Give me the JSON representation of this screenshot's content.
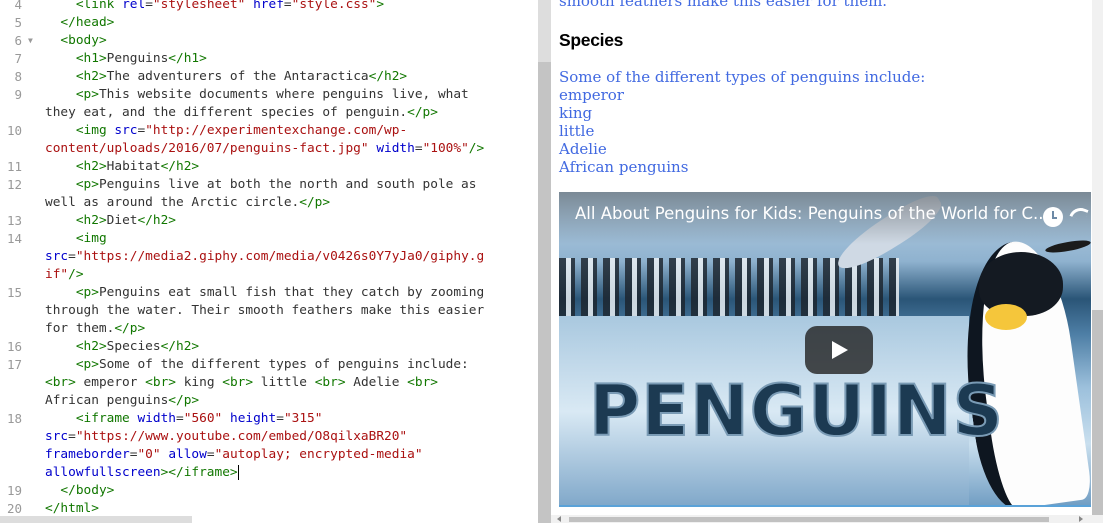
{
  "editor": {
    "lines": [
      {
        "number": "4",
        "fold": "",
        "rows": [
          [
            [
              "p",
              "    "
            ],
            [
              "t",
              "<link"
            ],
            [
              "p",
              " "
            ],
            [
              "a",
              "rel"
            ],
            [
              "p",
              "="
            ],
            [
              "s",
              "\"stylesheet\""
            ],
            [
              "p",
              " "
            ],
            [
              "a",
              "href"
            ],
            [
              "p",
              "="
            ],
            [
              "s",
              "\"style.css\""
            ],
            [
              "t",
              ">"
            ]
          ]
        ]
      },
      {
        "number": "5",
        "fold": "",
        "rows": [
          [
            [
              "p",
              "  "
            ],
            [
              "t",
              "</head>"
            ]
          ]
        ]
      },
      {
        "number": "6",
        "fold": "▼",
        "rows": [
          [
            [
              "p",
              "  "
            ],
            [
              "t",
              "<body>"
            ]
          ]
        ]
      },
      {
        "number": "7",
        "fold": "",
        "rows": [
          [
            [
              "p",
              "    "
            ],
            [
              "t",
              "<h1>"
            ],
            [
              "p",
              "Penguins"
            ],
            [
              "t",
              "</h1>"
            ]
          ]
        ]
      },
      {
        "number": "8",
        "fold": "",
        "rows": [
          [
            [
              "p",
              "    "
            ],
            [
              "t",
              "<h2>"
            ],
            [
              "p",
              "The adventurers of the Antaractica"
            ],
            [
              "t",
              "</h2>"
            ]
          ]
        ]
      },
      {
        "number": "9",
        "fold": "",
        "rows": [
          [
            [
              "p",
              "    "
            ],
            [
              "t",
              "<p>"
            ],
            [
              "p",
              "This website documents where penguins live, what"
            ]
          ],
          [
            [
              "p",
              "they eat, and the different species of penguin."
            ],
            [
              "t",
              "</p>"
            ]
          ]
        ]
      },
      {
        "number": "10",
        "fold": "",
        "rows": [
          [
            [
              "p",
              "    "
            ],
            [
              "t",
              "<img"
            ],
            [
              "p",
              " "
            ],
            [
              "a",
              "src"
            ],
            [
              "p",
              "="
            ],
            [
              "s",
              "\"http://experimentexchange.com/wp-"
            ]
          ],
          [
            [
              "s",
              "content/uploads/2016/07/penguins-fact.jpg\""
            ],
            [
              "p",
              " "
            ],
            [
              "a",
              "width"
            ],
            [
              "p",
              "="
            ],
            [
              "s",
              "\"100%\""
            ],
            [
              "t",
              "/>"
            ]
          ]
        ]
      },
      {
        "number": "11",
        "fold": "",
        "rows": [
          [
            [
              "p",
              "    "
            ],
            [
              "t",
              "<h2>"
            ],
            [
              "p",
              "Habitat"
            ],
            [
              "t",
              "</h2>"
            ]
          ]
        ]
      },
      {
        "number": "12",
        "fold": "",
        "rows": [
          [
            [
              "p",
              "    "
            ],
            [
              "t",
              "<p>"
            ],
            [
              "p",
              "Penguins live at both the north and south pole as"
            ]
          ],
          [
            [
              "p",
              "well as around the Arctic circle."
            ],
            [
              "t",
              "</p>"
            ]
          ]
        ]
      },
      {
        "number": "13",
        "fold": "",
        "rows": [
          [
            [
              "p",
              "    "
            ],
            [
              "t",
              "<h2>"
            ],
            [
              "p",
              "Diet"
            ],
            [
              "t",
              "</h2>"
            ]
          ]
        ]
      },
      {
        "number": "14",
        "fold": "",
        "rows": [
          [
            [
              "p",
              "    "
            ],
            [
              "t",
              "<img"
            ]
          ],
          [
            [
              "a",
              "src"
            ],
            [
              "p",
              "="
            ],
            [
              "s",
              "\"https://media2.giphy.com/media/v0426s0Y7yJa0/giphy.g"
            ]
          ],
          [
            [
              "s",
              "if\""
            ],
            [
              "t",
              "/>"
            ]
          ]
        ]
      },
      {
        "number": "15",
        "fold": "",
        "rows": [
          [
            [
              "p",
              "    "
            ],
            [
              "t",
              "<p>"
            ],
            [
              "p",
              "Penguins eat small fish that they catch by zooming"
            ]
          ],
          [
            [
              "p",
              "through the water. Their smooth feathers make this easier"
            ]
          ],
          [
            [
              "p",
              "for them."
            ],
            [
              "t",
              "</p>"
            ]
          ]
        ]
      },
      {
        "number": "16",
        "fold": "",
        "rows": [
          [
            [
              "p",
              "    "
            ],
            [
              "t",
              "<h2>"
            ],
            [
              "p",
              "Species"
            ],
            [
              "t",
              "</h2>"
            ]
          ]
        ]
      },
      {
        "number": "17",
        "fold": "",
        "rows": [
          [
            [
              "p",
              "    "
            ],
            [
              "t",
              "<p>"
            ],
            [
              "p",
              "Some of the different types of penguins include:"
            ]
          ],
          [
            [
              "t",
              "<br>"
            ],
            [
              "p",
              " emperor "
            ],
            [
              "t",
              "<br>"
            ],
            [
              "p",
              " king "
            ],
            [
              "t",
              "<br>"
            ],
            [
              "p",
              " little "
            ],
            [
              "t",
              "<br>"
            ],
            [
              "p",
              " Adelie "
            ],
            [
              "t",
              "<br>"
            ]
          ],
          [
            [
              "p",
              "African penguins"
            ],
            [
              "t",
              "</p>"
            ]
          ]
        ]
      },
      {
        "number": "18",
        "fold": "",
        "rows": [
          [
            [
              "p",
              "    "
            ],
            [
              "t",
              "<iframe"
            ],
            [
              "p",
              " "
            ],
            [
              "a",
              "width"
            ],
            [
              "p",
              "="
            ],
            [
              "s",
              "\"560\""
            ],
            [
              "p",
              " "
            ],
            [
              "a",
              "height"
            ],
            [
              "p",
              "="
            ],
            [
              "s",
              "\"315\""
            ]
          ],
          [
            [
              "a",
              "src"
            ],
            [
              "p",
              "="
            ],
            [
              "s",
              "\"https://www.youtube.com/embed/O8qilxaBR20\""
            ]
          ],
          [
            [
              "a",
              "frameborder"
            ],
            [
              "p",
              "="
            ],
            [
              "s",
              "\"0\""
            ],
            [
              "p",
              " "
            ],
            [
              "a",
              "allow"
            ],
            [
              "p",
              "="
            ],
            [
              "s",
              "\"autoplay; encrypted-media\""
            ]
          ],
          [
            [
              "a",
              "allowfullscreen"
            ],
            [
              "t",
              "></iframe>"
            ]
          ]
        ]
      },
      {
        "number": "19",
        "fold": "",
        "rows": [
          [
            [
              "p",
              "  "
            ],
            [
              "t",
              "</body>"
            ]
          ]
        ]
      },
      {
        "number": "20",
        "fold": "",
        "rows": [
          [
            [
              "t",
              "</html>"
            ]
          ]
        ]
      }
    ]
  },
  "preview": {
    "intro_tail": "smooth feathers make this easier for them.",
    "species_heading": "Species",
    "species_intro": "Some of the different types of penguins include:",
    "species": [
      "emperor",
      "king",
      "little",
      "Adelie",
      "African penguins"
    ],
    "video": {
      "title": "All About Penguins for Kids: Penguins of the World for C...",
      "wordmark": "PENGUINS",
      "icons": [
        "clock-icon",
        "share-icon",
        "play-icon"
      ]
    }
  },
  "colors": {
    "tag": "#117700",
    "attribute": "#0000cc",
    "string": "#aa1111",
    "preview_text": "#4169e1"
  }
}
